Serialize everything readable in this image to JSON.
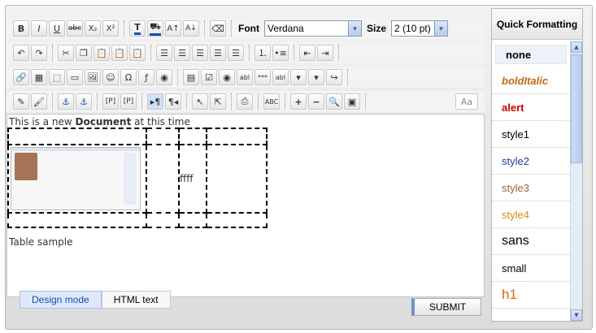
{
  "toolbar": {
    "font_label": "Font",
    "font_value": "Verdana",
    "size_label": "Size",
    "size_value": "2 (10 pt)",
    "text_bold": "B",
    "text_italic": "I",
    "text_underline": "U",
    "text_strike": "abc",
    "text_subscript": "X₂",
    "text_superscript": "X²",
    "text_p": "[P]",
    "text_p_div": "[P]",
    "text_textfield": "abl",
    "text_password": "***",
    "text_textarea": "abl",
    "text_abc": "ABC",
    "text_aa": "Aa"
  },
  "editor": {
    "line1_prefix": "This is a new ",
    "line1_bold": "Document",
    "line1_suffix": " at this time",
    "table_cell_text": "ffff",
    "caption": "Table sample"
  },
  "tabs": {
    "design": "Design mode",
    "html": "HTML text"
  },
  "submit_label": "SUBMIT",
  "quick_formatting": {
    "title": "Quick Formatting",
    "items": [
      {
        "label": "none",
        "color": "#000000",
        "style": "bold"
      },
      {
        "label": "boldItalic",
        "color": "#c06a12",
        "style": "bolditalic"
      },
      {
        "label": "alert",
        "color": "#cc0000",
        "style": "bold"
      },
      {
        "label": "style1",
        "color": "#000000",
        "style": "normal"
      },
      {
        "label": "style2",
        "color": "#1f3f9c",
        "style": "normal"
      },
      {
        "label": "style3",
        "color": "#a5612a",
        "style": "normal"
      },
      {
        "label": "style4",
        "color": "#e08a10",
        "style": "normal"
      },
      {
        "label": "sans",
        "color": "#000000",
        "style": "large"
      },
      {
        "label": "small",
        "color": "#000000",
        "style": "normal"
      },
      {
        "label": "h1",
        "color": "#d36b00",
        "style": "h1"
      }
    ]
  }
}
